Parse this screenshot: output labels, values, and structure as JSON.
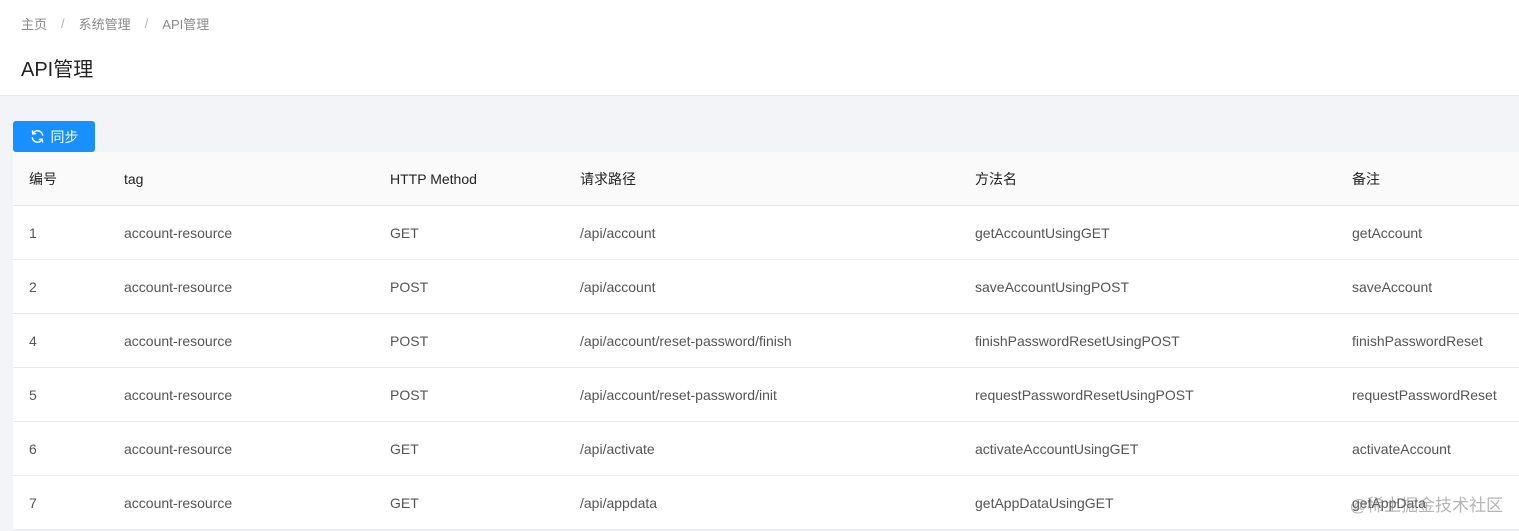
{
  "breadcrumb": {
    "home": "主页",
    "system": "系统管理",
    "current": "API管理",
    "separator": "/"
  },
  "page_title": "API管理",
  "toolbar": {
    "sync_label": "同步",
    "sync_icon": "refresh-icon",
    "accent_color": "#1890ff"
  },
  "table": {
    "columns": [
      "编号",
      "tag",
      "HTTP Method",
      "请求路径",
      "方法名",
      "备注"
    ],
    "rows": [
      [
        "1",
        "account-resource",
        "GET",
        "/api/account",
        "getAccountUsingGET",
        "getAccount"
      ],
      [
        "2",
        "account-resource",
        "POST",
        "/api/account",
        "saveAccountUsingPOST",
        "saveAccount"
      ],
      [
        "4",
        "account-resource",
        "POST",
        "/api/account/reset-password/finish",
        "finishPasswordResetUsingPOST",
        "finishPasswordReset"
      ],
      [
        "5",
        "account-resource",
        "POST",
        "/api/account/reset-password/init",
        "requestPasswordResetUsingPOST",
        "requestPasswordReset"
      ],
      [
        "6",
        "account-resource",
        "GET",
        "/api/activate",
        "activateAccountUsingGET",
        "activateAccount"
      ],
      [
        "7",
        "account-resource",
        "GET",
        "/api/appdata",
        "getAppDataUsingGET",
        "getAppData"
      ]
    ]
  },
  "watermark": "@稀土掘金技术社区"
}
